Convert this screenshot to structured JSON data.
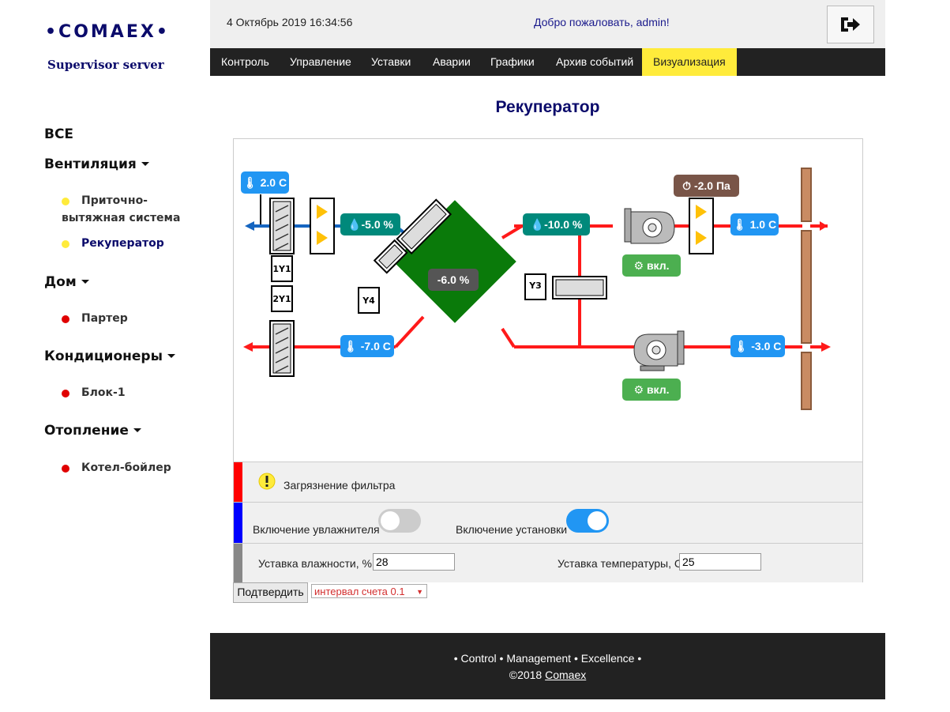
{
  "brand": {
    "logo": "•COMAEX•",
    "subtitle": "Supervisor server"
  },
  "header": {
    "datetime": "4 Октябрь 2019 16:34:56",
    "welcome": "Добро пожаловать, admin!",
    "logout_icon": "sign-out-icon"
  },
  "nav": {
    "items": [
      {
        "label": "Контроль"
      },
      {
        "label": "Управление"
      },
      {
        "label": "Уставки"
      },
      {
        "label": "Аварии"
      },
      {
        "label": "Графики"
      },
      {
        "label": "Архив событий"
      },
      {
        "label": "Визуализация"
      }
    ],
    "active": "Визуализация",
    "active_color": "#ffeb3b"
  },
  "sidebar": {
    "all": "ВСЕ",
    "groups": [
      {
        "label": "Вентиляция",
        "items": [
          {
            "label": "Приточно-вытяжная система",
            "status_color": "#ffeb3b"
          },
          {
            "label": "Рекуператор",
            "status_color": "#ffeb3b",
            "active": true
          }
        ]
      },
      {
        "label": "Дом",
        "items": [
          {
            "label": "Партер",
            "status_color": "#e00000"
          }
        ]
      },
      {
        "label": "Кондиционеры",
        "items": [
          {
            "label": "Блок-1",
            "status_color": "#e00000"
          }
        ]
      },
      {
        "label": "Отопление",
        "items": [
          {
            "label": "Котел-бойлер",
            "status_color": "#e00000"
          }
        ]
      }
    ]
  },
  "page": {
    "title": "Рекуператор"
  },
  "diagram": {
    "temp_outdoor_in": "2.0 C",
    "humidity_supply": "-5.0 %",
    "humidity_extract": "-10.0 %",
    "recuperator_value": "-6.0 %",
    "pressure": "-2.0 Па",
    "temp_supply": "1.0 C",
    "temp_exhaust": "-7.0 C",
    "temp_extract": "-3.0 C",
    "fan_supply_state": "вкл.",
    "fan_extract_state": "вкл.",
    "valve_labels": [
      "1Y1",
      "2Y1",
      "Y4",
      "Y3"
    ]
  },
  "alarm": {
    "text": "Загрязнение фильтра",
    "bar_color": "#ff0000",
    "icon": "warning-icon"
  },
  "switches": {
    "humidifier_label": "Включение увлажнителя",
    "humidifier_on": false,
    "unit_label": "Включение установки",
    "unit_on": true,
    "bar_color": "#0000ff"
  },
  "setpoints": {
    "humidity_label": "Уставка влажности, %",
    "humidity_value": "28",
    "temperature_label": "Уставка температуры, С",
    "temperature_value": "25",
    "bar_color": "#888888"
  },
  "actions": {
    "confirm": "Подтвердить",
    "interval": "интервал счета 0.1"
  },
  "footer": {
    "tagline": "• Control • Management • Excellence •",
    "copyright": "©2018 ",
    "link": "Comaex"
  }
}
